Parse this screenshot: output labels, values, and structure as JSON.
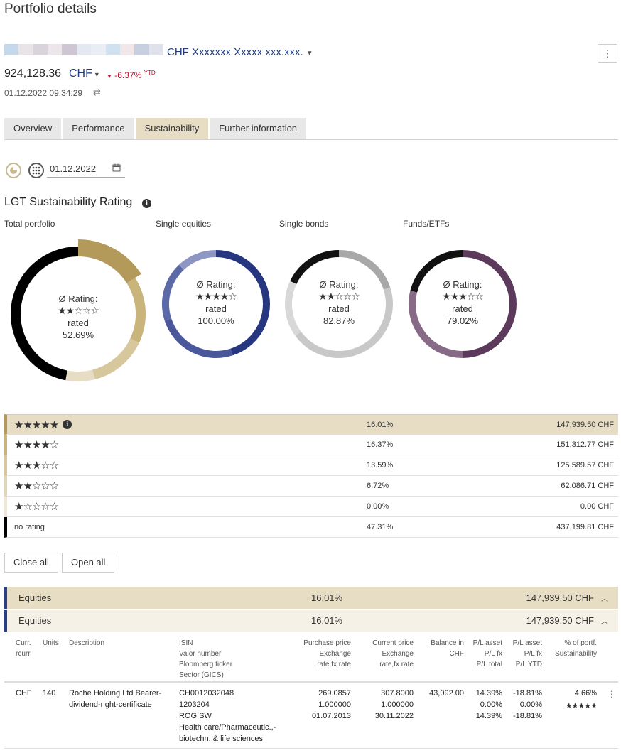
{
  "page": {
    "title": "Portfolio details"
  },
  "account": {
    "name": "CHF Xxxxxxx Xxxxx xxx.xxx.",
    "total_value": "924,128.36",
    "currency": "CHF",
    "ytd_change": "-6.37%",
    "ytd_label": "YTD",
    "timestamp": "01.12.2022 09:34:29"
  },
  "tabs": [
    {
      "label": "Overview",
      "active": false
    },
    {
      "label": "Performance",
      "active": false
    },
    {
      "label": "Sustainability",
      "active": true
    },
    {
      "label": "Further information",
      "active": false
    }
  ],
  "filters": {
    "date": "01.12.2022"
  },
  "sustainability": {
    "title": "LGT Sustainability Rating",
    "rating_label": "Ø Rating:",
    "rated_label": "rated",
    "donuts": [
      {
        "label": "Total portfolio",
        "stars": 2,
        "rated_pct": "52.69%",
        "color": "#000000"
      },
      {
        "label": "Single equities",
        "stars": 4,
        "rated_pct": "100.00%",
        "color": "#26367f"
      },
      {
        "label": "Single bonds",
        "stars": 2,
        "rated_pct": "82.87%",
        "color": "#111111"
      },
      {
        "label": "Funds/ETFs",
        "stars": 3,
        "rated_pct": "79.02%",
        "color": "#5b3a5c"
      }
    ]
  },
  "rating_table": [
    {
      "stars": 5,
      "label": "",
      "pct": "16.01%",
      "amount": "147,939.50 CHF",
      "color": "#b49a5a"
    },
    {
      "stars": 4,
      "label": "",
      "pct": "16.37%",
      "amount": "151,312.77 CHF",
      "color": "#c9b47c"
    },
    {
      "stars": 3,
      "label": "",
      "pct": "13.59%",
      "amount": "125,589.57 CHF",
      "color": "#d6c79c"
    },
    {
      "stars": 2,
      "label": "",
      "pct": "6.72%",
      "amount": "62,086.71 CHF",
      "color": "#e2d7b9"
    },
    {
      "stars": 1,
      "label": "",
      "pct": "0.00%",
      "amount": "0.00 CHF",
      "color": "#efe8d6"
    },
    {
      "stars": 0,
      "label": "no rating",
      "pct": "47.31%",
      "amount": "437,199.81 CHF",
      "color": "#000000"
    }
  ],
  "buttons": {
    "close_all": "Close all",
    "open_all": "Open all"
  },
  "groups": [
    {
      "label": "Equities",
      "pct": "16.01%",
      "amount": "147,939.50 CHF"
    },
    {
      "label": "Equities",
      "pct": "16.01%",
      "amount": "147,939.50 CHF"
    }
  ],
  "positions_table": {
    "headers": {
      "curr": [
        "Curr.",
        "rcurr."
      ],
      "units": [
        "Units"
      ],
      "description": [
        "Description"
      ],
      "isin": [
        "ISIN",
        "Valor number",
        "Bloomberg ticker",
        "Sector (GICS)"
      ],
      "purchase": [
        "Purchase price",
        "Exchange",
        "rate,fx rate"
      ],
      "current": [
        "Current price",
        "Exchange",
        "rate,fx rate"
      ],
      "balance": [
        "Balance in",
        "CHF"
      ],
      "pl_asset": [
        "P/L asset",
        "P/L fx",
        "P/L total"
      ],
      "pl_asset_ytd": [
        "P/L asset",
        "P/L fx",
        "P/L YTD"
      ],
      "pct_portf": [
        "% of portf.",
        "Sustainability"
      ]
    },
    "rows": [
      {
        "curr": "CHF",
        "units": "140",
        "description": [
          "Roche Holding Ltd Bearer-",
          "dividend-right-certificate"
        ],
        "isin": [
          "CH0012032048",
          "1203204",
          "ROG SW",
          "Health care/Pharmaceutic.,-",
          "biotechn. & life sciences"
        ],
        "purchase": [
          "269.0857",
          "1.000000",
          "01.07.2013"
        ],
        "current": [
          "307.8000",
          "1.000000",
          "30.11.2022"
        ],
        "balance": "43,092.00",
        "pl_asset": [
          "14.39%",
          "0.00%",
          "14.39%"
        ],
        "pl_asset_ytd": [
          "-18.81%",
          "0.00%",
          "-18.81%"
        ],
        "pct_portf": "4.66%",
        "sustainability_stars": 5
      }
    ]
  }
}
